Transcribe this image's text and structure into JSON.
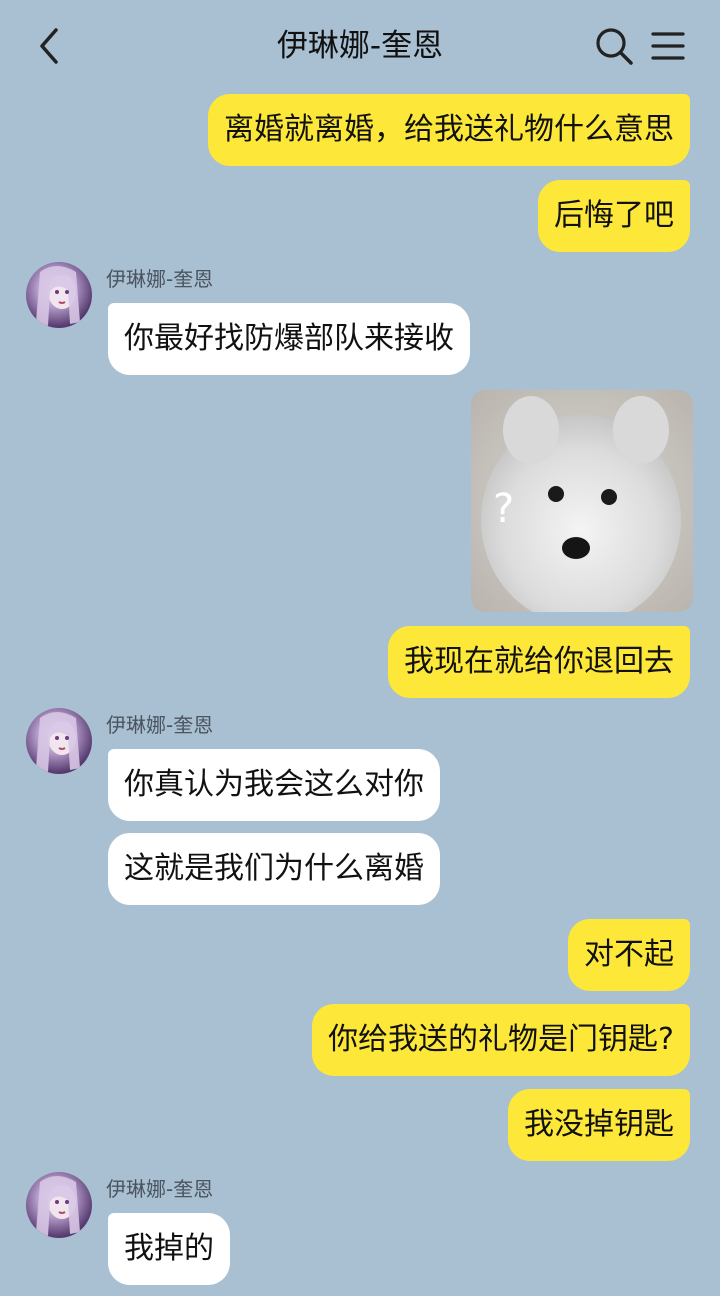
{
  "header": {
    "title": "伊琳娜-奎恩",
    "back_icon": "chevron-left-icon",
    "search_icon": "search-icon",
    "menu_icon": "menu-icon"
  },
  "colors": {
    "background": "#a9bfd2",
    "outgoing_bubble": "#fde83a",
    "incoming_bubble": "#ffffff"
  },
  "messages": [
    {
      "from": "me",
      "text": "离婚就离婚，给我送礼物什么意思"
    },
    {
      "from": "me",
      "text": "后悔了吧"
    },
    {
      "from": "them",
      "sender": "伊琳娜-奎恩",
      "text": "你最好找防爆部队来接收"
    },
    {
      "from": "me",
      "type": "sticker",
      "sticker": "fluffy-dog-question-sticker",
      "sticker_text": "?"
    },
    {
      "from": "me",
      "text": "我现在就给你退回去"
    },
    {
      "from": "them",
      "sender": "伊琳娜-奎恩",
      "text": "你真认为我会这么对你"
    },
    {
      "from": "them",
      "text": "这就是我们为什么离婚"
    },
    {
      "from": "me",
      "text": "对不起"
    },
    {
      "from": "me",
      "text": "你给我送的礼物是门钥匙?"
    },
    {
      "from": "me",
      "text": "我没掉钥匙"
    },
    {
      "from": "them",
      "sender": "伊琳娜-奎恩",
      "text": "我掉的"
    }
  ]
}
